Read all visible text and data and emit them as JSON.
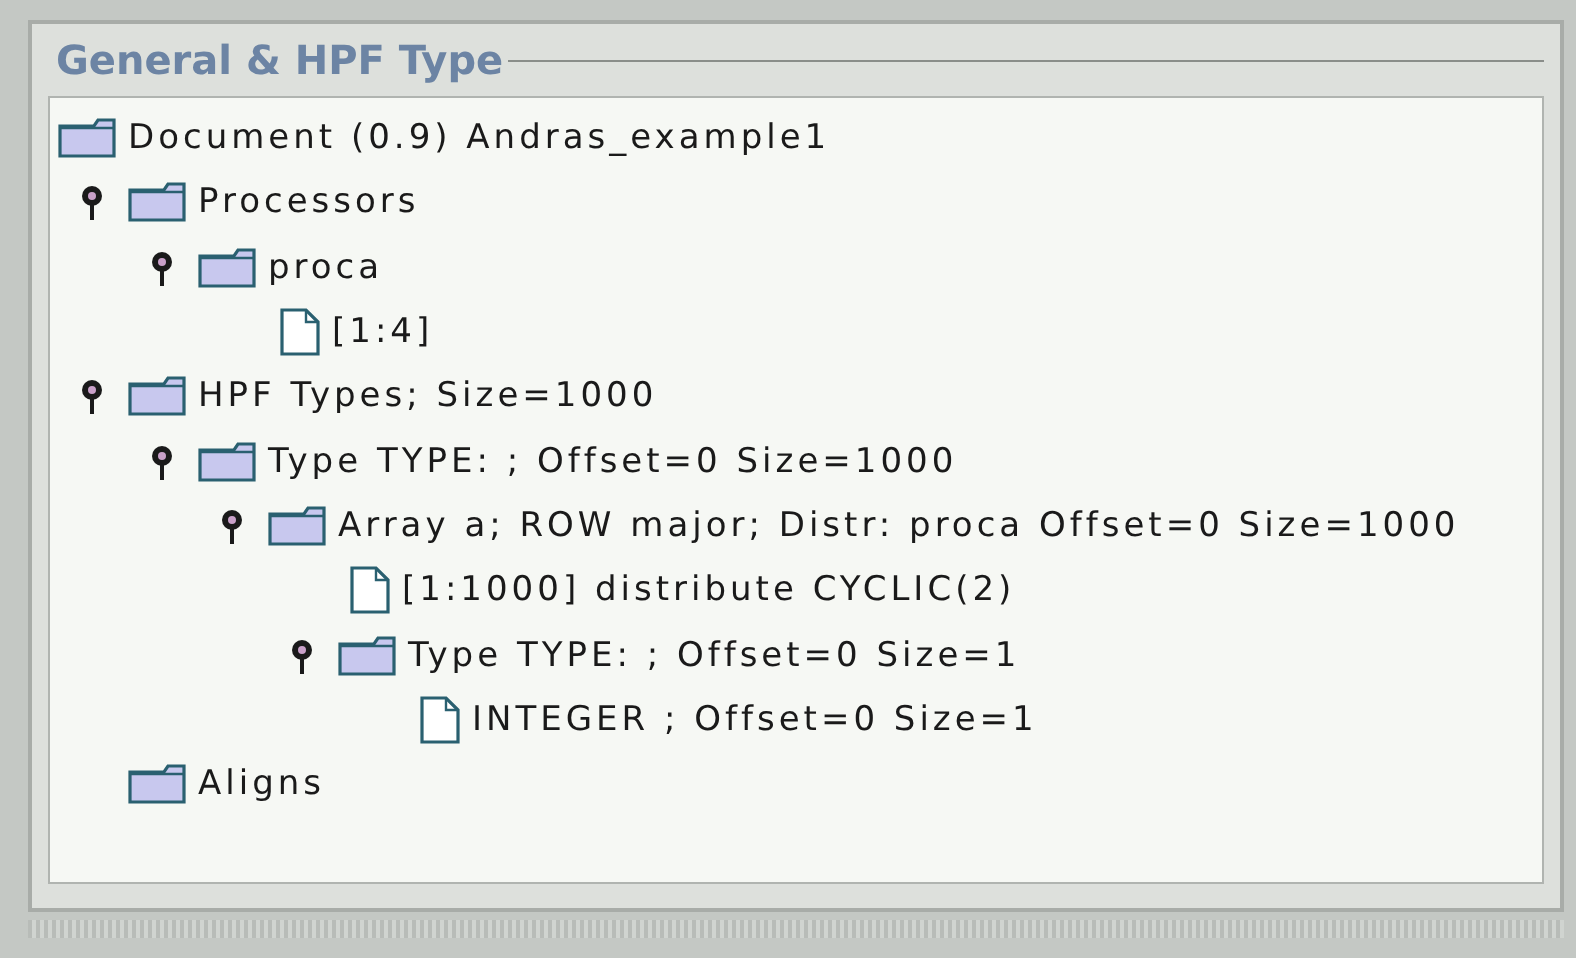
{
  "panel": {
    "title": "General & HPF Type"
  },
  "tree": [
    {
      "kind": "folder",
      "label": "Document (0.9) Andras_example1",
      "children": [
        {
          "kind": "folder",
          "label": "Processors",
          "expanded": true,
          "children": [
            {
              "kind": "folder",
              "label": "proca",
              "expanded": true,
              "children": [
                {
                  "kind": "file",
                  "label": "[1:4]"
                }
              ]
            }
          ]
        },
        {
          "kind": "folder",
          "label": "HPF Types; Size=1000",
          "expanded": true,
          "children": [
            {
              "kind": "folder",
              "label": "Type TYPE: ; Offset=0 Size=1000",
              "expanded": true,
              "children": [
                {
                  "kind": "folder",
                  "label": "Array a; ROW major; Distr: proca Offset=0 Size=1000",
                  "expanded": true,
                  "children": [
                    {
                      "kind": "file",
                      "label": "[1:1000] distribute CYCLIC(2)"
                    },
                    {
                      "kind": "folder",
                      "label": "Type TYPE: ; Offset=0 Size=1",
                      "expanded": true,
                      "children": [
                        {
                          "kind": "file",
                          "label": "INTEGER ; Offset=0 Size=1"
                        }
                      ]
                    }
                  ]
                }
              ]
            }
          ]
        },
        {
          "kind": "folder",
          "label": "Aligns"
        }
      ]
    }
  ]
}
